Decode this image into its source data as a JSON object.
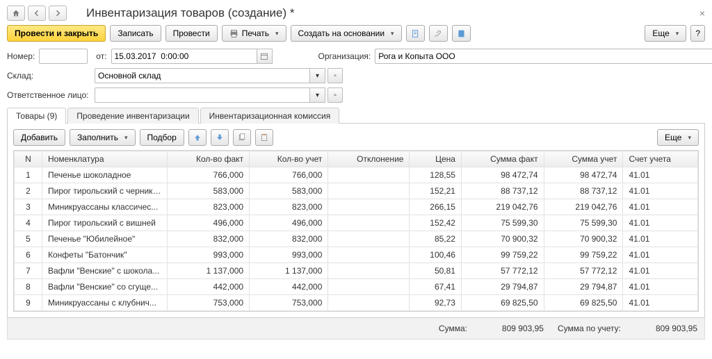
{
  "header": {
    "title": "Инвентаризация товаров (создание) *"
  },
  "toolbar": {
    "post_close": "Провести и закрыть",
    "save": "Записать",
    "post": "Провести",
    "print": "Печать",
    "create_basis": "Создать на основании",
    "more": "Еще"
  },
  "form": {
    "number_label": "Номер:",
    "date_label": "от:",
    "date_value": "15.03.2017  0:00:00",
    "org_label": "Организация:",
    "org_value": "Рога и Копыта ООО",
    "warehouse_label": "Склад:",
    "warehouse_value": "Основной склад",
    "responsible_label": "Ответственное лицо:"
  },
  "tabs": [
    "Товары (9)",
    "Проведение инвентаризации",
    "Инвентаризационная комиссия"
  ],
  "tab_toolbar": {
    "add": "Добавить",
    "fill": "Заполнить",
    "select": "Подбор",
    "more": "Еще"
  },
  "columns": {
    "n": "N",
    "nom": "Номенклатура",
    "qty_fact": "Кол-во факт",
    "qty_acc": "Кол-во учет",
    "dev": "Отклонение",
    "price": "Цена",
    "sum_fact": "Сумма факт",
    "sum_acc": "Сумма учет",
    "account": "Счет учета"
  },
  "rows": [
    {
      "n": "1",
      "nom": "Печенье шоколадное",
      "qf": "766,000",
      "qa": "766,000",
      "dev": "",
      "pr": "128,55",
      "sf": "98 472,74",
      "sa": "98 472,74",
      "ac": "41.01"
    },
    {
      "n": "2",
      "nom": "Пирог тирольский с черникой",
      "qf": "583,000",
      "qa": "583,000",
      "dev": "",
      "pr": "152,21",
      "sf": "88 737,12",
      "sa": "88 737,12",
      "ac": "41.01"
    },
    {
      "n": "3",
      "nom": "Миникруассаны классичес...",
      "qf": "823,000",
      "qa": "823,000",
      "dev": "",
      "pr": "266,15",
      "sf": "219 042,76",
      "sa": "219 042,76",
      "ac": "41.01"
    },
    {
      "n": "4",
      "nom": "Пирог тирольский с вишней",
      "qf": "496,000",
      "qa": "496,000",
      "dev": "",
      "pr": "152,42",
      "sf": "75 599,30",
      "sa": "75 599,30",
      "ac": "41.01"
    },
    {
      "n": "5",
      "nom": "Печенье \"Юбилейное\"",
      "qf": "832,000",
      "qa": "832,000",
      "dev": "",
      "pr": "85,22",
      "sf": "70 900,32",
      "sa": "70 900,32",
      "ac": "41.01"
    },
    {
      "n": "6",
      "nom": "Конфеты \"Батончик\"",
      "qf": "993,000",
      "qa": "993,000",
      "dev": "",
      "pr": "100,46",
      "sf": "99 759,22",
      "sa": "99 759,22",
      "ac": "41.01"
    },
    {
      "n": "7",
      "nom": "Вафли \"Венские\" с шокола...",
      "qf": "1 137,000",
      "qa": "1 137,000",
      "dev": "",
      "pr": "50,81",
      "sf": "57 772,12",
      "sa": "57 772,12",
      "ac": "41.01"
    },
    {
      "n": "8",
      "nom": "Вафли \"Венские\" со сгуще...",
      "qf": "442,000",
      "qa": "442,000",
      "dev": "",
      "pr": "67,41",
      "sf": "29 794,87",
      "sa": "29 794,87",
      "ac": "41.01"
    },
    {
      "n": "9",
      "nom": "Миникруассаны с клубнич...",
      "qf": "753,000",
      "qa": "753,000",
      "dev": "",
      "pr": "92,73",
      "sf": "69 825,50",
      "sa": "69 825,50",
      "ac": "41.01"
    }
  ],
  "totals": {
    "sum_label": "Сумма:",
    "sum_value": "809 903,95",
    "sum_acc_label": "Сумма по учету:",
    "sum_acc_value": "809 903,95"
  }
}
